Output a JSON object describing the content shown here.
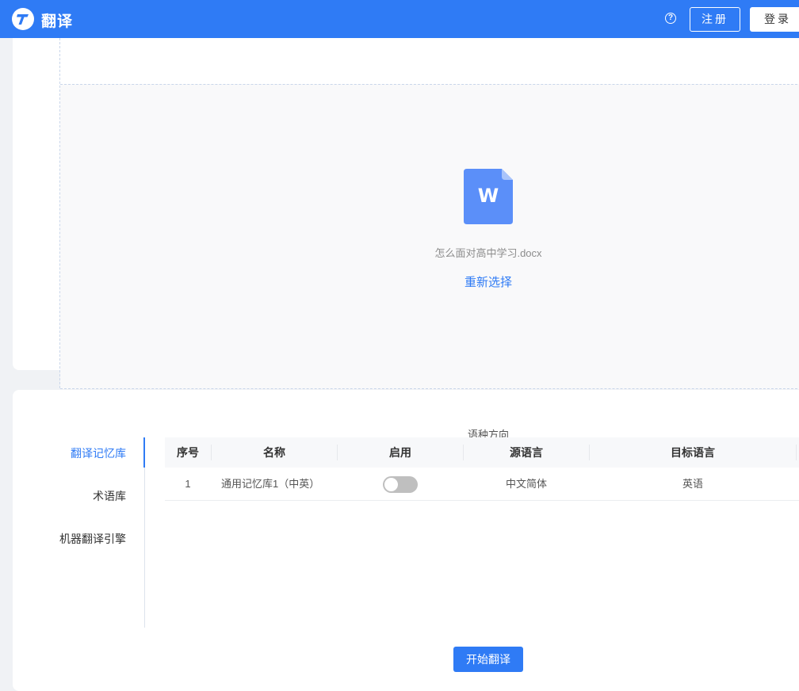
{
  "header": {
    "brand": "翻译",
    "help_glyph": "?",
    "register_label": "注册",
    "login_label": "登录",
    "colors": {
      "primary": "#2f7bf5"
    }
  },
  "upload": {
    "file_icon_letter": "W",
    "filename": "怎么面对高中学习.docx",
    "reselect_label": "重新选择"
  },
  "sidebar": {
    "items": [
      {
        "label": "翻译记忆库",
        "active": true
      },
      {
        "label": "术语库",
        "active": false
      },
      {
        "label": "机器翻译引擎",
        "active": false
      }
    ]
  },
  "table": {
    "group_header": "语种方向",
    "columns": [
      "序号",
      "名称",
      "启用",
      "源语言",
      "目标语言"
    ],
    "rows": [
      {
        "index": "1",
        "name": "通用记忆库1（中英）",
        "enabled": false,
        "source": "中文简体",
        "target": "英语"
      }
    ]
  },
  "actions": {
    "start_label": "开始翻译"
  }
}
